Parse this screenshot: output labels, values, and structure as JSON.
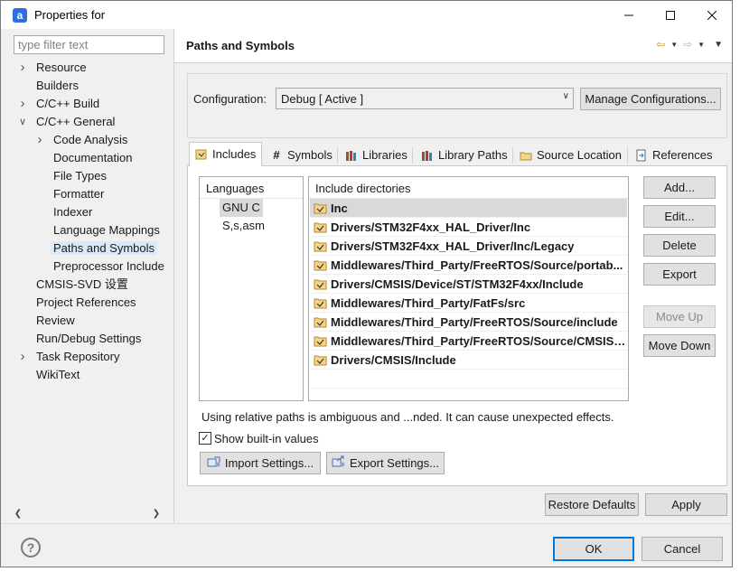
{
  "window": {
    "title": "Properties for",
    "controls": [
      "minimize",
      "maximize",
      "close"
    ]
  },
  "sidebar": {
    "filter_placeholder": "type filter text",
    "items": [
      {
        "label": "Resource",
        "expandable": true,
        "expanded": false,
        "level": 0
      },
      {
        "label": "Builders",
        "expandable": false,
        "level": 0
      },
      {
        "label": "C/C++ Build",
        "expandable": true,
        "expanded": false,
        "level": 0
      },
      {
        "label": "C/C++ General",
        "expandable": true,
        "expanded": true,
        "level": 0
      },
      {
        "label": "Code Analysis",
        "expandable": true,
        "expanded": false,
        "level": 1
      },
      {
        "label": "Documentation",
        "expandable": false,
        "level": 1
      },
      {
        "label": "File Types",
        "expandable": false,
        "level": 1
      },
      {
        "label": "Formatter",
        "expandable": false,
        "level": 1
      },
      {
        "label": "Indexer",
        "expandable": false,
        "level": 1
      },
      {
        "label": "Language Mappings",
        "expandable": false,
        "level": 1
      },
      {
        "label": "Paths and Symbols",
        "expandable": false,
        "level": 1,
        "selected": true
      },
      {
        "label": "Preprocessor Include",
        "expandable": false,
        "level": 1
      },
      {
        "label": "CMSIS-SVD 设置",
        "expandable": false,
        "level": 0
      },
      {
        "label": "Project References",
        "expandable": false,
        "level": 0
      },
      {
        "label": "Review",
        "expandable": false,
        "level": 0
      },
      {
        "label": "Run/Debug Settings",
        "expandable": false,
        "level": 0
      },
      {
        "label": "Task Repository",
        "expandable": true,
        "expanded": false,
        "level": 0
      },
      {
        "label": "WikiText",
        "expandable": false,
        "level": 0
      }
    ]
  },
  "main": {
    "title": "Paths and Symbols",
    "configuration_label": "Configuration:",
    "configuration_value": "Debug  [ Active ]",
    "manage_button": "Manage Configurations...",
    "tabs": [
      {
        "label": "Includes",
        "active": true
      },
      {
        "label": "Symbols",
        "active": false
      },
      {
        "label": "Libraries",
        "active": false
      },
      {
        "label": "Library Paths",
        "active": false
      },
      {
        "label": "Source Location",
        "active": false
      },
      {
        "label": "References",
        "active": false
      }
    ],
    "languages_header": "Languages",
    "languages": [
      "GNU C",
      "S,s,asm"
    ],
    "include_header": "Include directories",
    "include_dirs": [
      "Inc",
      "Drivers/STM32F4xx_HAL_Driver/Inc",
      "Drivers/STM32F4xx_HAL_Driver/Inc/Legacy",
      "Middlewares/Third_Party/FreeRTOS/Source/portab...",
      "Drivers/CMSIS/Device/ST/STM32F4xx/Include",
      "Middlewares/Third_Party/FatFs/src",
      "Middlewares/Third_Party/FreeRTOS/Source/include",
      "Middlewares/Third_Party/FreeRTOS/Source/CMSIS_...",
      "Drivers/CMSIS/Include"
    ],
    "side_buttons": {
      "add": "Add...",
      "edit": "Edit...",
      "delete": "Delete",
      "export": "Export",
      "move_up": "Move Up",
      "move_down": "Move Down"
    },
    "note": "Using relative paths is ambiguous and ...nded. It can cause unexpected effects.",
    "show_builtin_label": "Show built-in values",
    "show_builtin_checked": true,
    "import_button": "Import Settings...",
    "export_button": "Export Settings...",
    "restore_button": "Restore Defaults",
    "apply_button": "Apply"
  },
  "footer": {
    "ok_button": "OK",
    "cancel_button": "Cancel"
  },
  "colors": {
    "selection": "#d9e8fb",
    "accent": "#0078d7",
    "nav_arrow": "#c59a2a"
  }
}
